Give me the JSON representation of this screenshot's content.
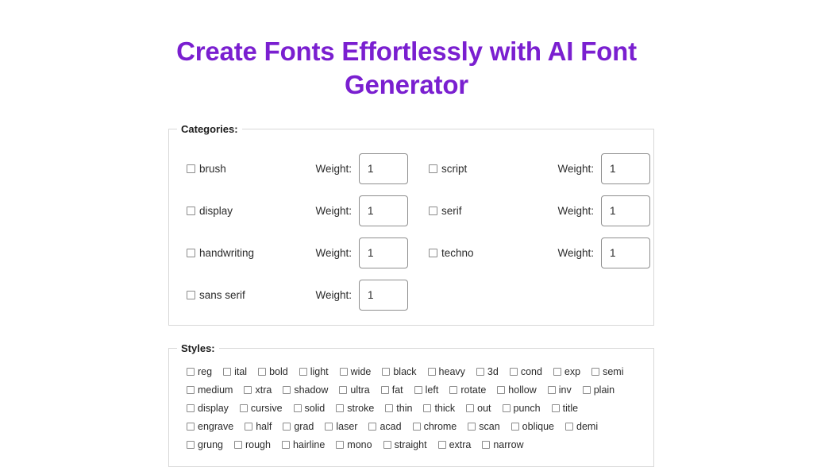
{
  "page": {
    "title": "Create Fonts Effortlessly with AI Font Generator",
    "title_color": "#7a1fd0",
    "background_color": "#ffffff"
  },
  "categories": {
    "legend": "Categories:",
    "weight_label": "Weight:",
    "items": [
      {
        "label": "brush",
        "weight": "1",
        "checked": false
      },
      {
        "label": "script",
        "weight": "1",
        "checked": false
      },
      {
        "label": "display",
        "weight": "1",
        "checked": false
      },
      {
        "label": "serif",
        "weight": "1",
        "checked": false
      },
      {
        "label": "handwriting",
        "weight": "1",
        "checked": false
      },
      {
        "label": "techno",
        "weight": "1",
        "checked": false
      },
      {
        "label": "sans serif",
        "weight": "1",
        "checked": false
      }
    ]
  },
  "styles": {
    "legend": "Styles:",
    "rows": [
      [
        "reg",
        "ital",
        "bold",
        "light",
        "wide",
        "black",
        "heavy",
        "3d",
        "cond",
        "exp",
        "semi"
      ],
      [
        "medium",
        "xtra",
        "shadow",
        "ultra",
        "fat",
        "left",
        "rotate",
        "hollow",
        "inv",
        "plain"
      ],
      [
        "display",
        "cursive",
        "solid",
        "stroke",
        "thin",
        "thick",
        "out",
        "punch",
        "title"
      ],
      [
        "engrave",
        "half",
        "grad",
        "laser",
        "acad",
        "chrome",
        "scan",
        "oblique",
        "demi"
      ],
      [
        "grung",
        "rough",
        "hairline",
        "mono",
        "straight",
        "extra",
        "narrow"
      ]
    ]
  }
}
